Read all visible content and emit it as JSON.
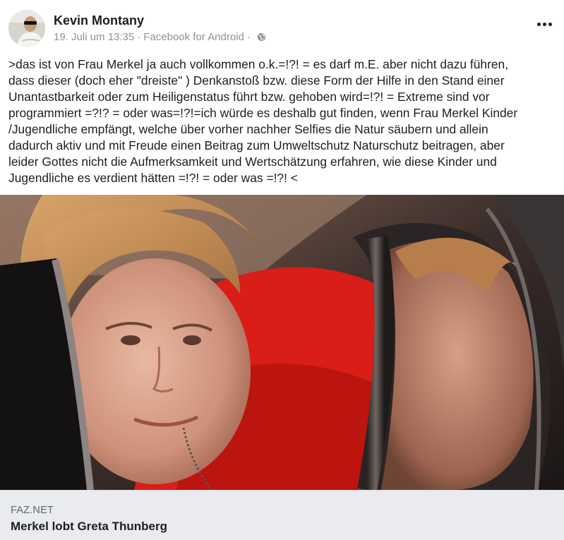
{
  "post": {
    "author": "Kevin Montany",
    "date": "19. Juli um 13:35",
    "separator": "·",
    "source": "Facebook for Android",
    "privacy_icon": "globe-icon",
    "more_icon": "more-options-icon",
    "text": ">das ist von Frau Merkel ja auch vollkommen o.k.=!?! = es darf m.E. aber nicht dazu führen,\ndass dieser (doch eher \"dreiste\" ) Denkanstoß bzw. diese Form der Hilfe in den Stand einer\nUnantastbarkeit oder zum Heiligenstatus führt bzw. gehoben wird=!?! = Extreme sind vor\nprogrammiert =?!? = oder was=!?!=ich würde es deshalb gut finden, wenn Frau Merkel Kinder\n/Jugendliche empfängt, welche über vorher nachher Selfies die Natur säubern und allein\ndadurch aktiv und mit Freude einen Beitrag zum Umweltschutz Naturschutz beitragen, aber\nleider Gottes nicht die Aufmerksamkeit und Wertschätzung erfahren, wie diese Kinder und\nJugendliche es verdient hätten =!?! = oder was =!?! <"
  },
  "link": {
    "domain": "FAZ.NET",
    "title": "Merkel lobt Greta Thunberg",
    "image_alt": "Merkel mit Spiegel"
  }
}
